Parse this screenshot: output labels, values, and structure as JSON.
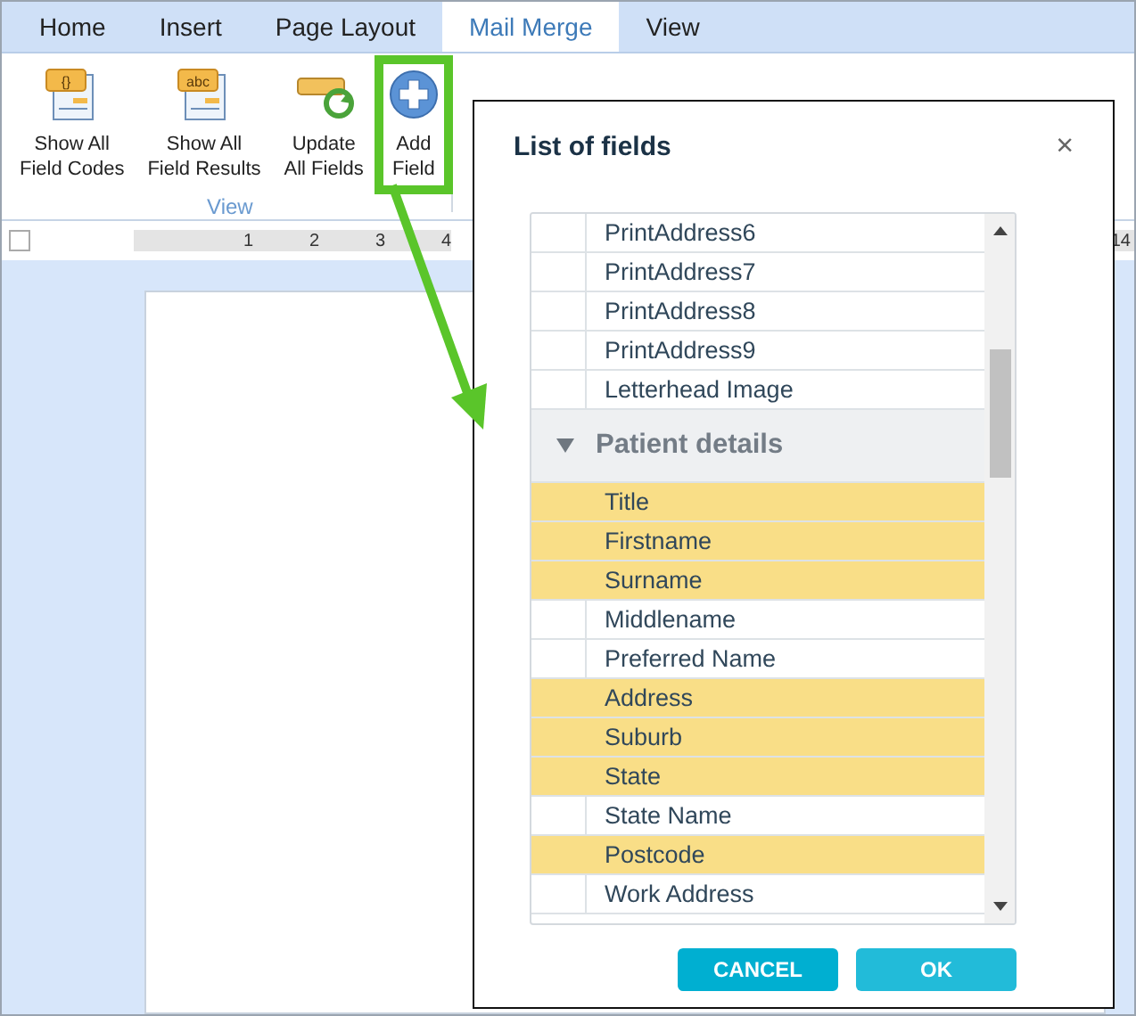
{
  "tabs": [
    {
      "label": "Home",
      "selected": false
    },
    {
      "label": "Insert",
      "selected": false
    },
    {
      "label": "Page Layout",
      "selected": false
    },
    {
      "label": "Mail Merge",
      "selected": true
    },
    {
      "label": "View",
      "selected": false
    }
  ],
  "ribbon": {
    "group_label": "View",
    "buttons": [
      {
        "kind": "codes",
        "icon_text": "{}",
        "line1": "Show All",
        "line2": "Field Codes",
        "highlighted": false
      },
      {
        "kind": "results",
        "icon_text": "abc",
        "line1": "Show All",
        "line2": "Field Results",
        "highlighted": false
      },
      {
        "kind": "update",
        "line1": "Update",
        "line2": "All Fields",
        "highlighted": false
      },
      {
        "kind": "add",
        "line1": "Add",
        "line2": "Field",
        "highlighted": true
      }
    ]
  },
  "ruler": {
    "left_numbers": [
      "1",
      "2",
      "3",
      "4"
    ],
    "right_numbers": [
      "14"
    ]
  },
  "dialog": {
    "title": "List of fields",
    "close": "×",
    "items": [
      {
        "kind": "field",
        "label": "PrintAddress6",
        "highlighted": false
      },
      {
        "kind": "field",
        "label": "PrintAddress7",
        "highlighted": false
      },
      {
        "kind": "field",
        "label": "PrintAddress8",
        "highlighted": false
      },
      {
        "kind": "field",
        "label": "PrintAddress9",
        "highlighted": false
      },
      {
        "kind": "field",
        "label": "Letterhead Image",
        "highlighted": false
      },
      {
        "kind": "group",
        "label": "Patient details",
        "expanded": true
      },
      {
        "kind": "field",
        "label": "Title",
        "highlighted": true
      },
      {
        "kind": "field",
        "label": "Firstname",
        "highlighted": true
      },
      {
        "kind": "field",
        "label": "Surname",
        "highlighted": true
      },
      {
        "kind": "field",
        "label": "Middlename",
        "highlighted": false
      },
      {
        "kind": "field",
        "label": "Preferred Name",
        "highlighted": false
      },
      {
        "kind": "field",
        "label": "Address",
        "highlighted": true
      },
      {
        "kind": "field",
        "label": "Suburb",
        "highlighted": true
      },
      {
        "kind": "field",
        "label": "State",
        "highlighted": true
      },
      {
        "kind": "field",
        "label": "State Name",
        "highlighted": false
      },
      {
        "kind": "field",
        "label": "Postcode",
        "highlighted": true
      },
      {
        "kind": "field",
        "label": "Work Address",
        "highlighted": false
      }
    ],
    "buttons": [
      {
        "kind": "cancel",
        "label": "CANCEL"
      },
      {
        "kind": "ok",
        "label": "OK"
      }
    ]
  }
}
